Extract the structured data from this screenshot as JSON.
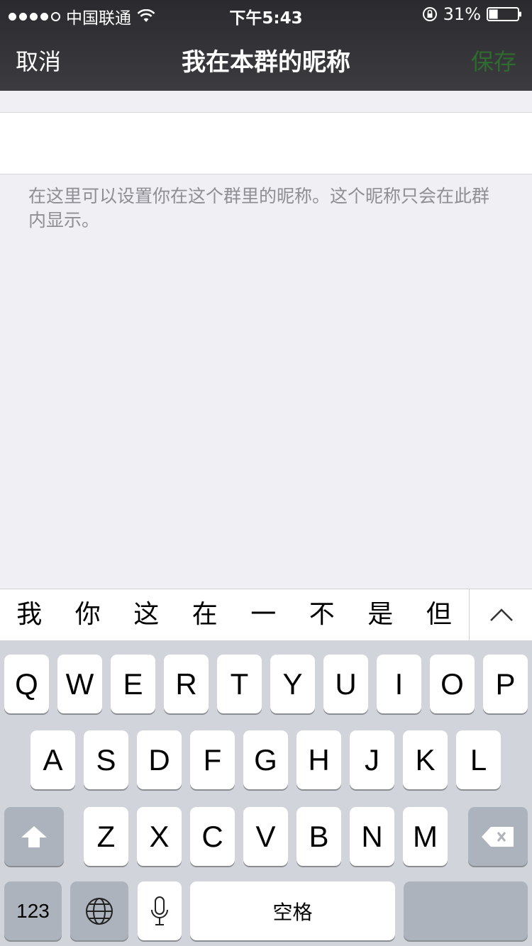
{
  "status": {
    "carrier": "中国联通",
    "time": "下午5:43",
    "battery": "31%",
    "battery_level": 0.31
  },
  "nav": {
    "cancel": "取消",
    "title": "我在本群的昵称",
    "save": "保存"
  },
  "input": {
    "value": "",
    "placeholder": ""
  },
  "hint": "在这里可以设置你在这个群里的昵称。这个昵称只会在此群内显示。",
  "suggestions": [
    "我",
    "你",
    "这",
    "在",
    "一",
    "不",
    "是",
    "但"
  ],
  "keyboard": {
    "row1": [
      "Q",
      "W",
      "E",
      "R",
      "T",
      "Y",
      "U",
      "I",
      "O",
      "P"
    ],
    "row2": [
      "A",
      "S",
      "D",
      "F",
      "G",
      "H",
      "J",
      "K",
      "L"
    ],
    "row3": [
      "Z",
      "X",
      "C",
      "V",
      "B",
      "N",
      "M"
    ],
    "numbers": "123",
    "space": "空格"
  },
  "colors": {
    "header": "#333337",
    "save_disabled": "#2f6b2f",
    "background": "#efeff4",
    "keyboard": "#d1d5db"
  }
}
